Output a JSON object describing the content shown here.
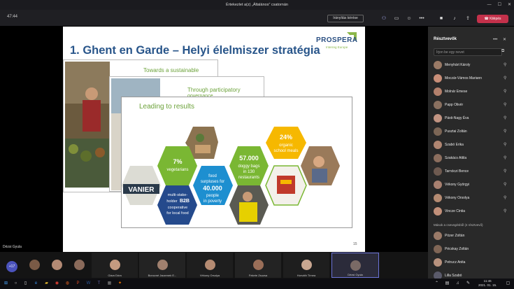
{
  "window": {
    "title": "Értekezlet a(z) „Általános” csatornán"
  },
  "toolbar": {
    "timer": "47:44",
    "stop_share_label": "Irányítás kérése",
    "leave_label": "Kilépés"
  },
  "slide": {
    "title": "1. Ghent en Garde – Helyi élelmiszer stratégia",
    "logo": "PROSPERA",
    "logo_sub": "Interreg Europe",
    "panel1_title": "Towards a sustainable",
    "panel2_title": "Through participatory",
    "panel2_title_cut": "governance",
    "panel3_title": "Leading to results",
    "hex_vanier": "VANIER",
    "hex_veg_num": "7%",
    "hex_veg_text": "vegetarians",
    "hex_b2b_1": "multi-stake-",
    "hex_b2b_2": "holder",
    "hex_b2b_3": "B2B",
    "hex_b2b_4": "cooperative",
    "hex_b2b_5": "for local food",
    "hex_food_1": "food",
    "hex_food_2": "surpluses for",
    "hex_food_3": "40.000",
    "hex_food_4": "people",
    "hex_food_5": "in poverty",
    "hex_doggy_1": "57.000",
    "hex_doggy_2": "doggy bags",
    "hex_doggy_3": "in 130",
    "hex_doggy_4": "restaurants",
    "hex_school_1": "24%",
    "hex_school_2": "organic",
    "hex_school_3": "school meals",
    "number": "15"
  },
  "presenter": {
    "name": "Dézsi Gyula"
  },
  "gallery": {
    "more_count": "+17",
    "tiles": [
      {
        "name": ""
      },
      {
        "name": ""
      },
      {
        "name": ""
      },
      {
        "name": "Gáva Dóra"
      },
      {
        "name": "Bonczné Jaczenek E..."
      },
      {
        "name": "Vékony Orsolya"
      },
      {
        "name": "Fekete Zsuzsa"
      },
      {
        "name": "Horváth Tímea"
      },
      {
        "name": "Dézsi Gyula"
      }
    ]
  },
  "participants_panel": {
    "title": "Résztvevők",
    "search_placeholder": "Írjon be egy nevet",
    "participants": [
      {
        "name": "Menyhárt Károly"
      },
      {
        "name": "Moczár-Vámos Mariann"
      },
      {
        "name": "Molnár Emese"
      },
      {
        "name": "Papp Olivér"
      },
      {
        "name": "Pásti-Nagy Éva"
      },
      {
        "name": "Pusztai Zoltán"
      },
      {
        "name": "Szabó Erika"
      },
      {
        "name": "Szakács Attila"
      },
      {
        "name": "Tarnóczi Bence"
      },
      {
        "name": "Vékony Györgyi"
      },
      {
        "name": "Vékony Orsolya"
      },
      {
        "name": "Vincze Cintia"
      }
    ],
    "others_section": "Mások a csevegésből (4 résztvevő)",
    "others": [
      {
        "name": "Pózer Zoltán"
      },
      {
        "name": "Pécskay Zoltán"
      },
      {
        "name": "Petrucz Anita"
      },
      {
        "name": "Lilla Szabó"
      }
    ]
  },
  "taskbar": {
    "time": "11:46",
    "date": "2021. 01. 15."
  },
  "colors": {
    "accent": "#4b53bc",
    "leave": "#c4314b",
    "hex_green": "#7ab733",
    "hex_blue": "#1d8fd0",
    "hex_yellow": "#f6b800",
    "hex_navy": "#254a8c"
  }
}
